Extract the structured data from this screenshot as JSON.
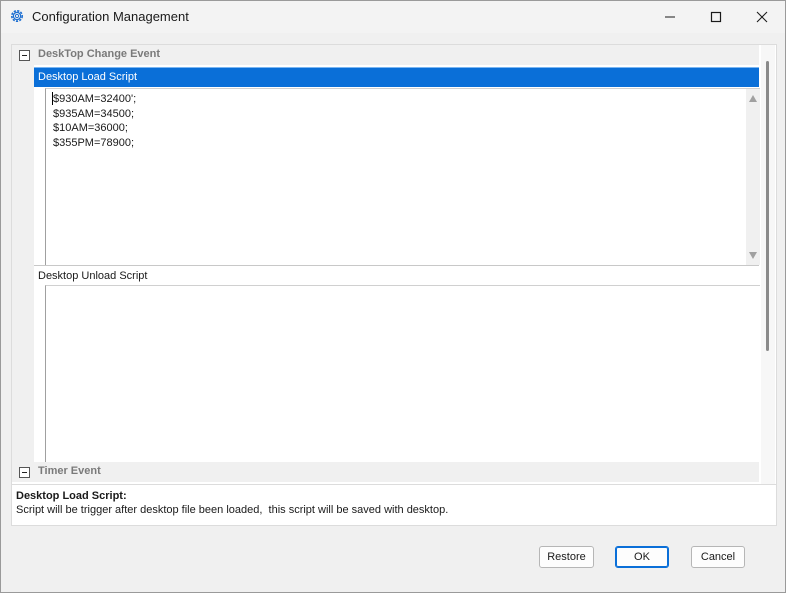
{
  "window": {
    "title": "Configuration Management",
    "icon": "gear-icon"
  },
  "categories": [
    {
      "label": "DeskTop Change Event",
      "expanded": true,
      "properties": [
        {
          "label": "Desktop Load Script",
          "selected": true,
          "lines": [
            "$930AM=32400';",
            "$935AM=34500;",
            "$10AM=36000;",
            "$355PM=78900;"
          ]
        },
        {
          "label": "Desktop Unload Script",
          "selected": false,
          "lines": []
        }
      ]
    },
    {
      "label": "Timer Event",
      "expanded": true,
      "properties": []
    }
  ],
  "description": {
    "title": "Desktop Load Script:",
    "text": "Script will be trigger after desktop file been loaded,  this script will be saved with desktop."
  },
  "buttons": {
    "restore": "Restore",
    "ok": "OK",
    "cancel": "Cancel"
  },
  "colors": {
    "selection": "#0a6fd8",
    "background": "#f0f0f0"
  }
}
